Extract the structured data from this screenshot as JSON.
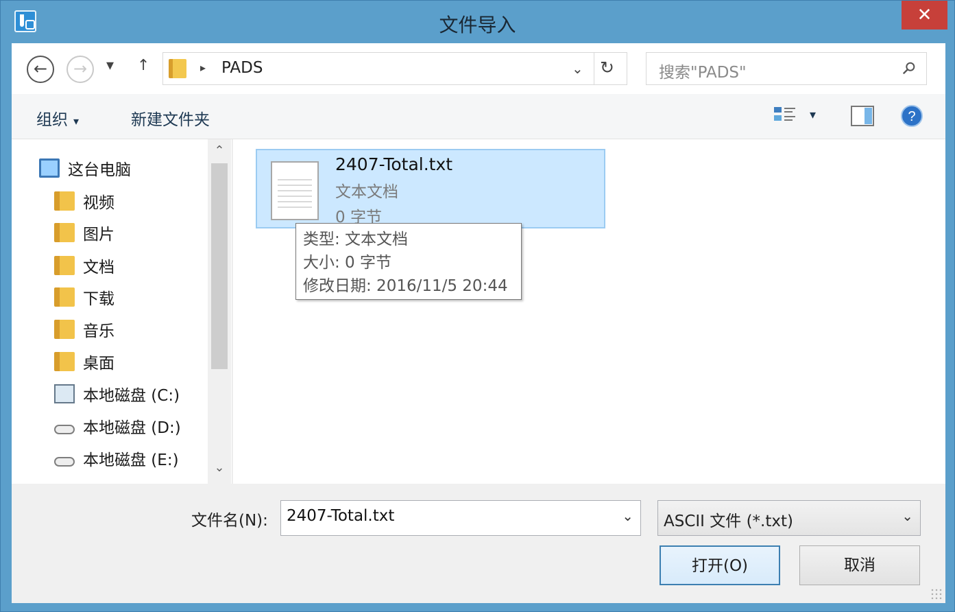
{
  "window": {
    "title": "文件导入",
    "close_glyph": "✕"
  },
  "navigation": {
    "back_glyph": "←",
    "forward_glyph": "→",
    "recent_glyph": "▾",
    "up_glyph": "↑",
    "refresh_glyph": "↻",
    "path": [
      "PADS"
    ],
    "search_placeholder": "搜索\"PADS\"",
    "address_dropdown_glyph": "⌄",
    "crumb_arrow_glyph": "▸"
  },
  "toolbar": {
    "organize_label": "组织",
    "new_folder_label": "新建文件夹",
    "view_caret": "▾"
  },
  "sidebar": {
    "items": [
      {
        "label": "这台电脑",
        "icon": "computer-icon"
      },
      {
        "label": "视频",
        "icon": "video-folder-icon"
      },
      {
        "label": "图片",
        "icon": "pictures-folder-icon"
      },
      {
        "label": "文档",
        "icon": "documents-folder-icon"
      },
      {
        "label": "下载",
        "icon": "downloads-folder-icon"
      },
      {
        "label": "音乐",
        "icon": "music-folder-icon"
      },
      {
        "label": "桌面",
        "icon": "desktop-folder-icon"
      },
      {
        "label": "本地磁盘 (C:)",
        "icon": "system-drive-icon"
      },
      {
        "label": "本地磁盘 (D:)",
        "icon": "drive-icon"
      },
      {
        "label": "本地磁盘 (E:)",
        "icon": "drive-icon"
      }
    ],
    "scroll_up_glyph": "⌃",
    "scroll_down_glyph": "⌄"
  },
  "files": [
    {
      "name": "2407-Total.txt",
      "type": "文本文档",
      "size": "0 字节"
    }
  ],
  "tooltip": {
    "type": "类型: 文本文档",
    "size": "大小: 0 字节",
    "modified": "修改日期: 2016/11/5 20:44"
  },
  "footer": {
    "filename_label": "文件名(N):",
    "filename_value": "2407-Total.txt",
    "filter_value": "ASCII 文件 (*.txt)",
    "dropdown_glyph": "⌄",
    "open_label": "打开(O)",
    "cancel_label": "取消"
  },
  "colors": {
    "titlebar": "#5b9fcb",
    "close": "#c7403a",
    "selection": "#cce8ff",
    "primary_border": "#3c7fb1"
  }
}
